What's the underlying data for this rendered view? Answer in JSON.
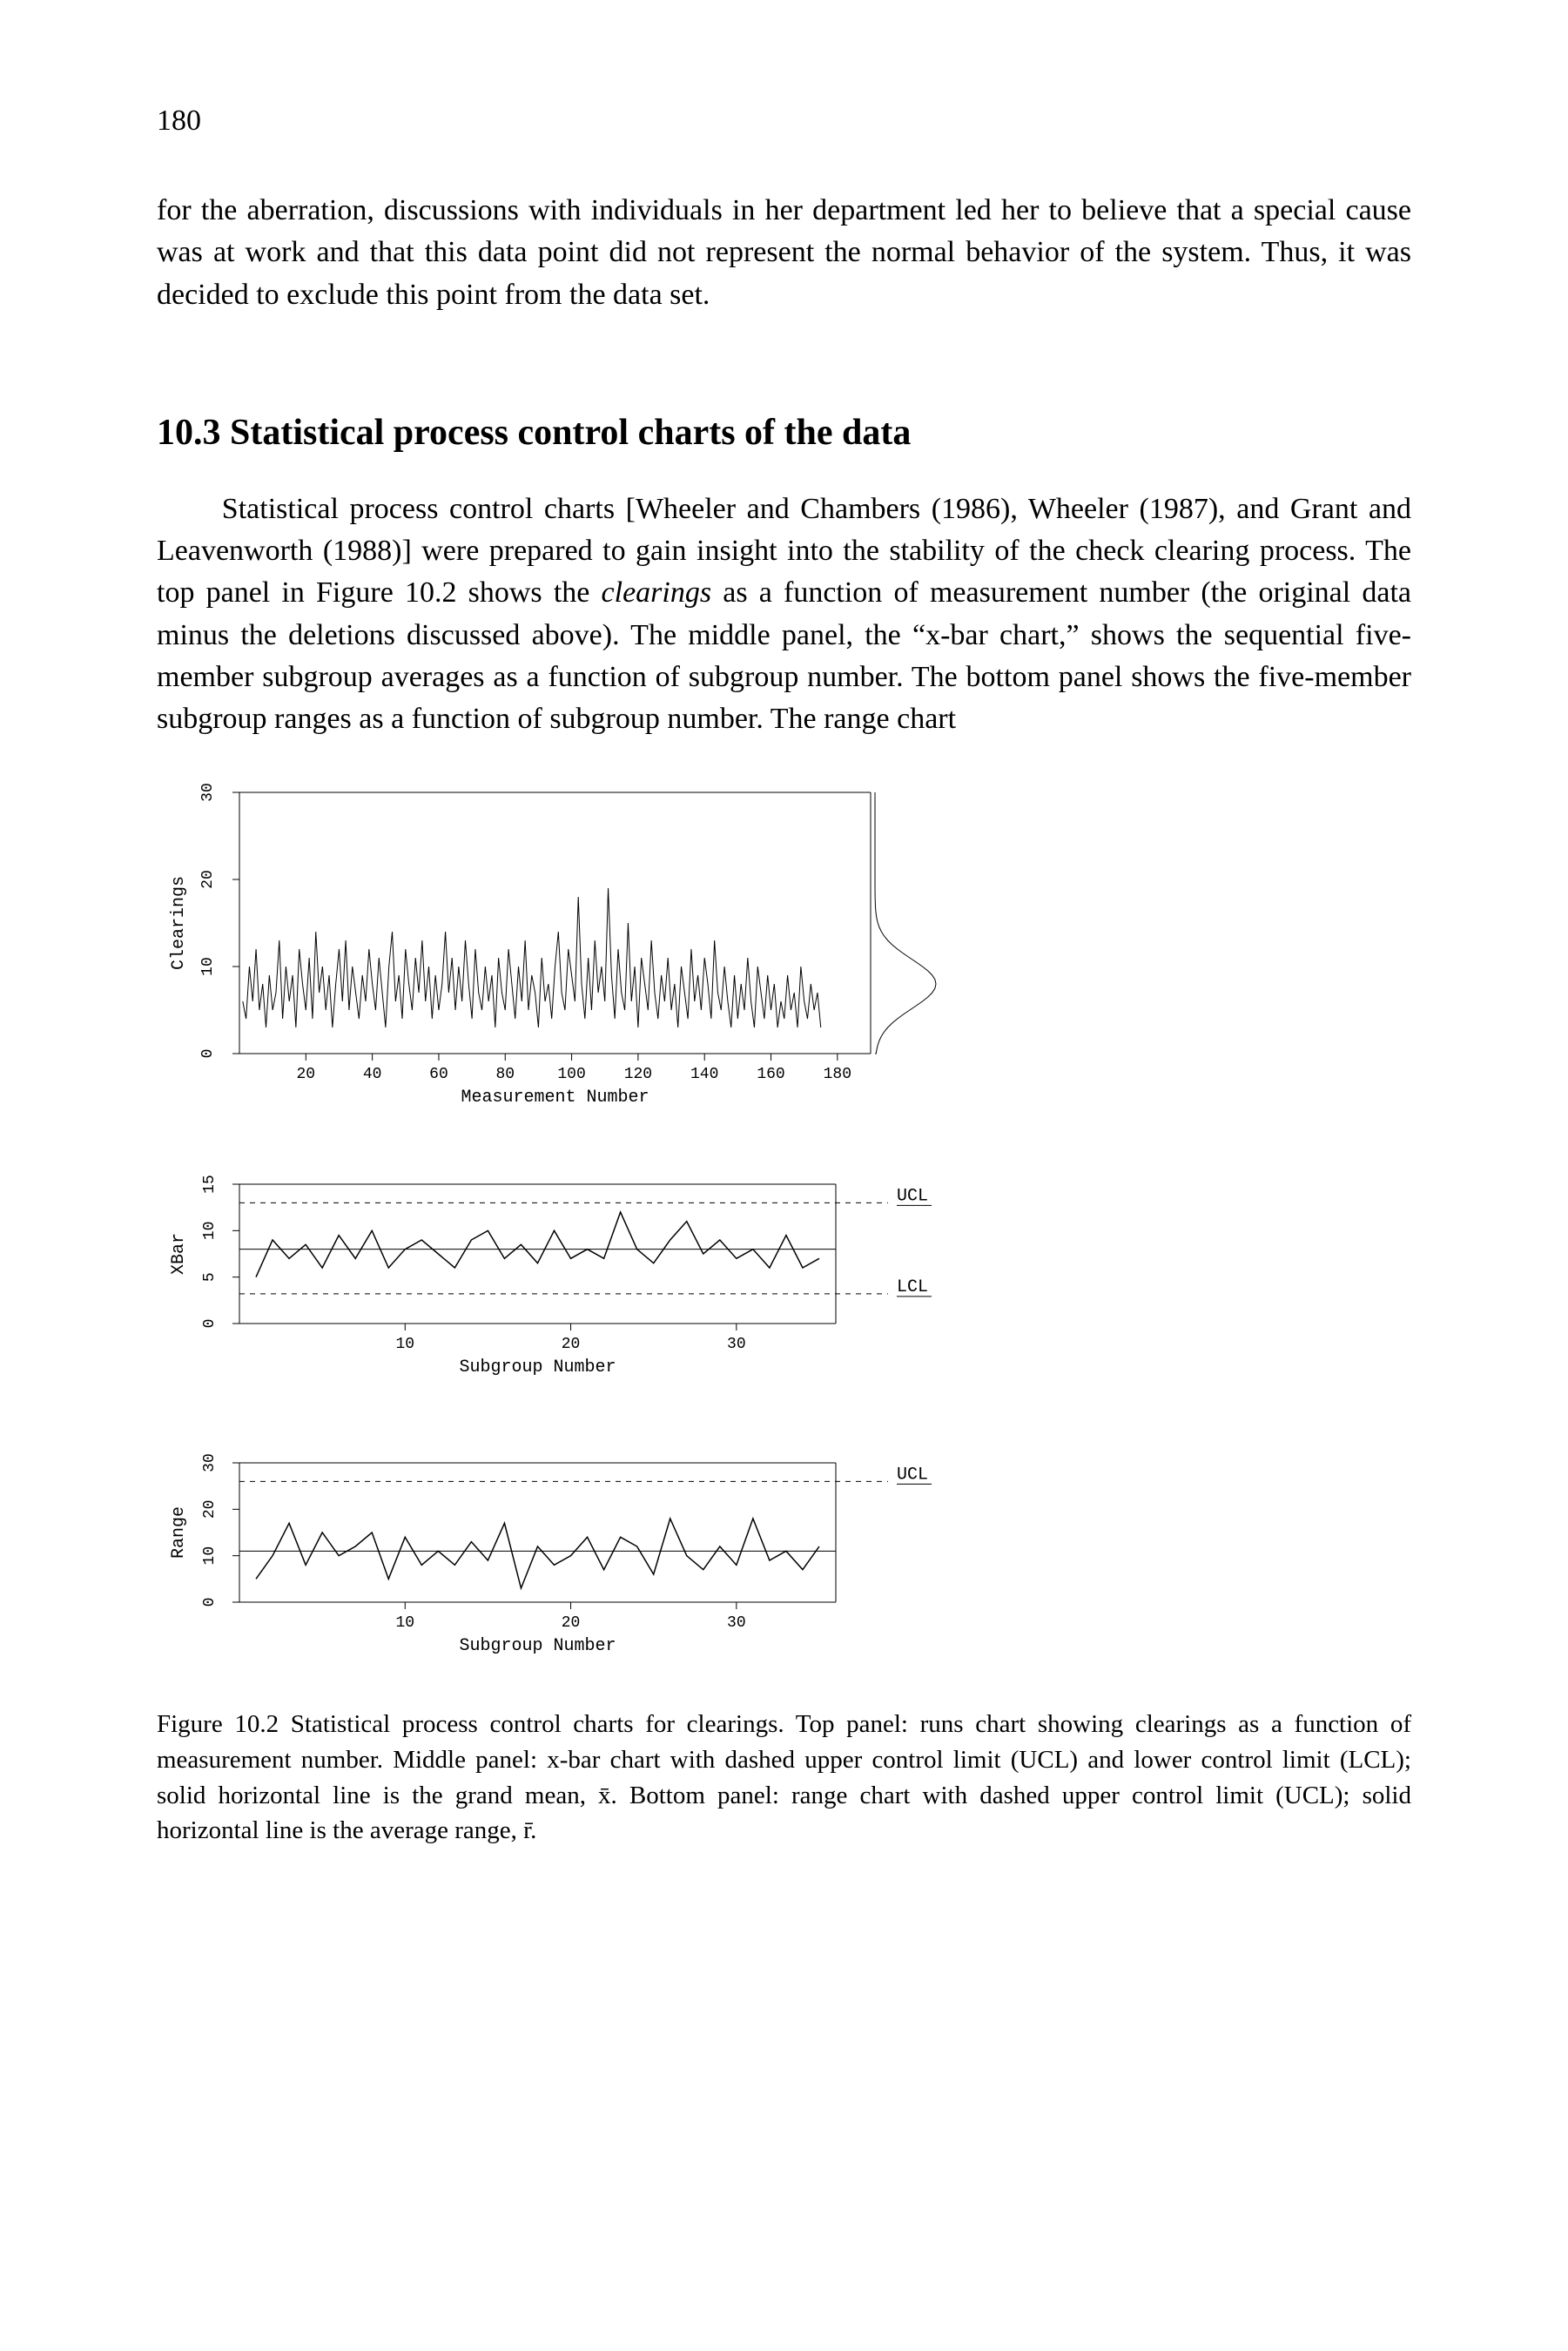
{
  "page_number": "180",
  "intro_paragraph": "for the aberration, discussions with individuals in her department led her to believe that a special cause was at work and that this data point did not represent the normal behavior of the system. Thus, it was decided to exclude this point from the data set.",
  "section_heading": "10.3 Statistical process control charts of the data",
  "section_paragraph_pre": "Statistical process control charts [Wheeler and Chambers (1986), Wheeler (1987), and Grant and Leavenworth (1988)] were prepared to gain insight into the stability of the check clearing process. The top panel in Figure 10.2 shows the ",
  "section_paragraph_italic": "clearings",
  "section_paragraph_post": " as a function of measurement number (the original data minus the deletions discussed above). The middle panel, the “x-bar chart,” shows the sequential five-member subgroup averages as a function of subgroup number. The bottom panel shows the five-member subgroup ranges as a function of subgroup number. The range chart",
  "caption": "Figure 10.2 Statistical process control charts for clearings. Top panel: runs chart showing clearings as a function of measurement number. Middle panel: x-bar chart with dashed upper control limit (UCL) and lower control limit (LCL); solid horizontal line is the grand mean, x̄. Bottom panel: range chart with dashed upper control limit (UCL); solid horizontal line is the average range, r̄.",
  "chart_data": [
    {
      "type": "line",
      "title": "Clearings runs chart",
      "xlabel": "Measurement Number",
      "ylabel": "Clearings",
      "x": [
        1,
        2,
        3,
        4,
        5,
        6,
        7,
        8,
        9,
        10,
        11,
        12,
        13,
        14,
        15,
        16,
        17,
        18,
        19,
        20,
        21,
        22,
        23,
        24,
        25,
        26,
        27,
        28,
        29,
        30,
        31,
        32,
        33,
        34,
        35,
        36,
        37,
        38,
        39,
        40,
        41,
        42,
        43,
        44,
        45,
        46,
        47,
        48,
        49,
        50,
        51,
        52,
        53,
        54,
        55,
        56,
        57,
        58,
        59,
        60,
        61,
        62,
        63,
        64,
        65,
        66,
        67,
        68,
        69,
        70,
        71,
        72,
        73,
        74,
        75,
        76,
        77,
        78,
        79,
        80,
        81,
        82,
        83,
        84,
        85,
        86,
        87,
        88,
        89,
        90,
        91,
        92,
        93,
        94,
        95,
        96,
        97,
        98,
        99,
        100,
        101,
        102,
        103,
        104,
        105,
        106,
        107,
        108,
        109,
        110,
        111,
        112,
        113,
        114,
        115,
        116,
        117,
        118,
        119,
        120,
        121,
        122,
        123,
        124,
        125,
        126,
        127,
        128,
        129,
        130,
        131,
        132,
        133,
        134,
        135,
        136,
        137,
        138,
        139,
        140,
        141,
        142,
        143,
        144,
        145,
        146,
        147,
        148,
        149,
        150,
        151,
        152,
        153,
        154,
        155,
        156,
        157,
        158,
        159,
        160,
        161,
        162,
        163,
        164,
        165,
        166,
        167,
        168,
        169,
        170,
        171,
        172,
        173,
        174,
        175
      ],
      "values": [
        6,
        4,
        10,
        6,
        12,
        5,
        8,
        3,
        9,
        5,
        7,
        13,
        4,
        10,
        6,
        9,
        3,
        12,
        8,
        5,
        11,
        4,
        14,
        7,
        10,
        5,
        9,
        3,
        8,
        12,
        6,
        13,
        5,
        10,
        7,
        4,
        9,
        6,
        12,
        8,
        5,
        11,
        7,
        3,
        10,
        14,
        6,
        9,
        4,
        12,
        8,
        5,
        11,
        7,
        13,
        6,
        10,
        4,
        9,
        5,
        8,
        14,
        7,
        11,
        5,
        10,
        6,
        13,
        8,
        4,
        12,
        7,
        5,
        10,
        6,
        9,
        3,
        11,
        7,
        5,
        12,
        8,
        4,
        10,
        6,
        13,
        5,
        9,
        7,
        3,
        11,
        6,
        8,
        4,
        10,
        14,
        7,
        5,
        12,
        9,
        6,
        18,
        8,
        4,
        11,
        5,
        13,
        7,
        10,
        6,
        19,
        9,
        4,
        12,
        7,
        5,
        15,
        6,
        10,
        3,
        11,
        8,
        5,
        13,
        7,
        4,
        9,
        6,
        11,
        5,
        8,
        3,
        10,
        7,
        4,
        12,
        6,
        9,
        5,
        11,
        8,
        4,
        13,
        7,
        5,
        10,
        6,
        3,
        9,
        4,
        8,
        5,
        11,
        6,
        3,
        10,
        7,
        4,
        9,
        5,
        8,
        3,
        6,
        4,
        9,
        5,
        7,
        3,
        10,
        6,
        4,
        8,
        5,
        7,
        3
      ],
      "xlim": [
        0,
        190
      ],
      "ylim": [
        0,
        30
      ],
      "xticks": [
        20,
        40,
        60,
        80,
        100,
        120,
        140,
        160,
        180
      ],
      "yticks": [
        0,
        10,
        20,
        30
      ]
    },
    {
      "type": "line",
      "title": "XBar chart",
      "xlabel": "Subgroup Number",
      "ylabel": "XBar",
      "x": [
        1,
        2,
        3,
        4,
        5,
        6,
        7,
        8,
        9,
        10,
        11,
        12,
        13,
        14,
        15,
        16,
        17,
        18,
        19,
        20,
        21,
        22,
        23,
        24,
        25,
        26,
        27,
        28,
        29,
        30,
        31,
        32,
        33,
        34,
        35
      ],
      "values": [
        5,
        9,
        7,
        8.5,
        6,
        9.5,
        7,
        10,
        6,
        8,
        9,
        7.5,
        6,
        9,
        10,
        7,
        8.5,
        6.5,
        10,
        7,
        8,
        7,
        12,
        8,
        6.5,
        9,
        11,
        7.5,
        9,
        7,
        8,
        6,
        9.5,
        6,
        7
      ],
      "grand_mean": 8,
      "ucl": 13,
      "lcl": 3.2,
      "xlim": [
        0,
        36
      ],
      "ylim": [
        0,
        15
      ],
      "xticks": [
        10,
        20,
        30
      ],
      "yticks": [
        0,
        5,
        10,
        15
      ],
      "ucl_label": "UCL",
      "lcl_label": "LCL"
    },
    {
      "type": "line",
      "title": "Range chart",
      "xlabel": "Subgroup Number",
      "ylabel": "Range",
      "x": [
        1,
        2,
        3,
        4,
        5,
        6,
        7,
        8,
        9,
        10,
        11,
        12,
        13,
        14,
        15,
        16,
        17,
        18,
        19,
        20,
        21,
        22,
        23,
        24,
        25,
        26,
        27,
        28,
        29,
        30,
        31,
        32,
        33,
        34,
        35
      ],
      "values": [
        5,
        10,
        17,
        8,
        15,
        10,
        12,
        15,
        5,
        14,
        8,
        11,
        8,
        13,
        9,
        17,
        3,
        12,
        8,
        10,
        14,
        7,
        14,
        12,
        6,
        18,
        10,
        7,
        12,
        8,
        18,
        9,
        11,
        7,
        12
      ],
      "mean_range": 11,
      "ucl": 26,
      "xlim": [
        0,
        36
      ],
      "ylim": [
        0,
        30
      ],
      "xticks": [
        10,
        20,
        30
      ],
      "yticks": [
        0,
        10,
        20,
        30
      ],
      "ucl_label": "UCL"
    }
  ]
}
